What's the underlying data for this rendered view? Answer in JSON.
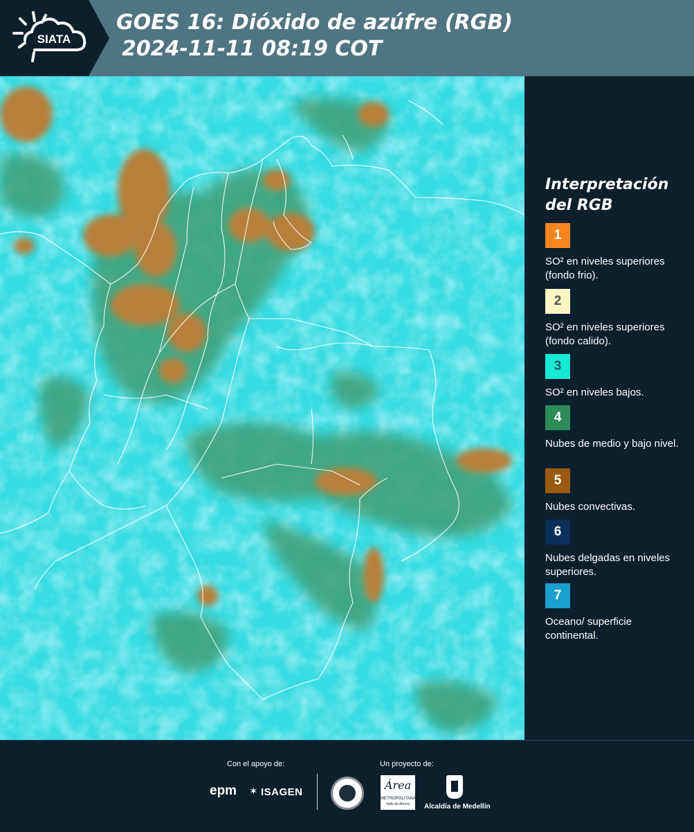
{
  "header": {
    "logo_text": "SIATA",
    "title_line1": "GOES 16: Dióxido de azúfre (RGB)",
    "title_line2": "2024-11-11 08:19 COT"
  },
  "legend": {
    "title_line1": "Interpretación",
    "title_line2": "del RGB",
    "items": [
      {
        "number": "1",
        "color": "#f7861f",
        "text_color": "#ffffff",
        "text": "SO² en niveles superiores (fondo frio)."
      },
      {
        "number": "2",
        "color": "#fdf6c3",
        "text_color": "#555555",
        "text": "SO² en niveles superiores (fondo calido)."
      },
      {
        "number": "3",
        "color": "#17ead3",
        "text_color": "#2b5a66",
        "text": "SO² en niveles bajos."
      },
      {
        "number": "4",
        "color": "#2e8b57",
        "text_color": "#ffffff",
        "text": "Nubes de medio y bajo nivel."
      },
      {
        "number": "5",
        "color": "#9a5a12",
        "text_color": "#ffffff",
        "text": "Nubes convectivas."
      },
      {
        "number": "6",
        "color": "#0c2f5c",
        "text_color": "#ffffff",
        "text": "Nubes delgadas en niveles superiores."
      },
      {
        "number": "7",
        "color": "#1a9fcf",
        "text_color": "#ffffff",
        "text": "Oceano/ superficie continental."
      }
    ]
  },
  "footer": {
    "support_label": "Con el apoyo de:",
    "project_label": "Un proyecto de:",
    "epm": "epm",
    "isagen": "ISAGEN",
    "area_name": "Área",
    "area_sub1": "METROPOLITANA",
    "area_sub2": "Valle de Aburrá",
    "alcaldia": "Alcaldía de Medellín"
  },
  "colors": {
    "header_bg": "#4f7484",
    "page_bg": "#0b1f2d",
    "cloud_cyan": "#36dbe3",
    "convective_brown": "#b8803a",
    "midlevel_green": "#3f9e74"
  }
}
